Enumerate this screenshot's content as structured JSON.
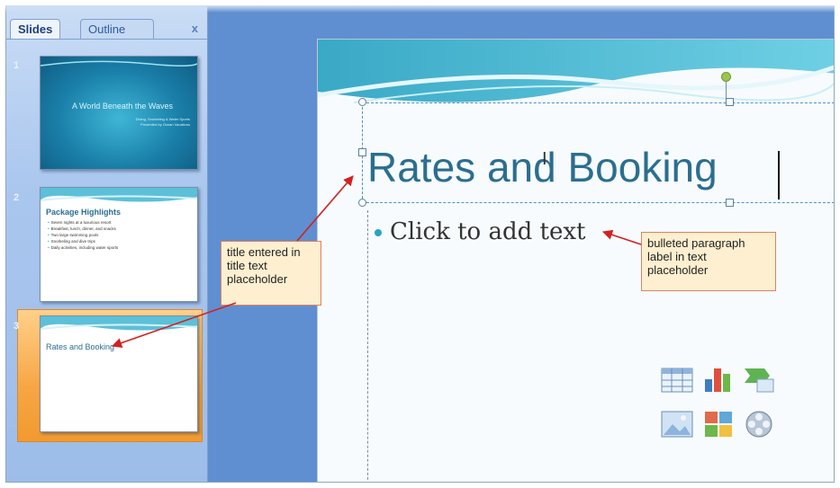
{
  "pane": {
    "tabs": [
      {
        "label": "Slides"
      },
      {
        "label": "Outline"
      }
    ],
    "close_label": "x",
    "slides": [
      {
        "number": "1",
        "title": "A World Beneath the Waves",
        "subtitle_lines": [
          "Diving, Snorkeling & Water Sports",
          "Presented by Ocean Vacations"
        ]
      },
      {
        "number": "2",
        "title": "Package Highlights",
        "bullets": [
          "Seven nights at a luxurious resort",
          "Breakfast, lunch, dinner, and snacks",
          "Two large swimming pools",
          "Snorkeling and dive trips",
          "Daily activities, including water sports"
        ]
      },
      {
        "number": "3",
        "title": "Rates and Booking"
      }
    ]
  },
  "slide": {
    "title": "Rates and Booking",
    "ibeam": "I",
    "body_placeholder": "Click to add text"
  },
  "content_icons": [
    "table-icon",
    "chart-icon",
    "smartart-icon",
    "picture-icon",
    "clipart-icon",
    "media-clip-icon"
  ],
  "callouts": {
    "title": "title entered in title text placeholder",
    "bulleted": "bulleted paragraph label in text placeholder"
  },
  "colors": {
    "title_teal": "#2b6e8f",
    "bullet_cyan": "#29a3c3",
    "selection_orange": "#f7a543",
    "pane_blue": "#a9c6ee",
    "callout_fill": "#fdefcf",
    "arrow_red": "#d42020"
  }
}
